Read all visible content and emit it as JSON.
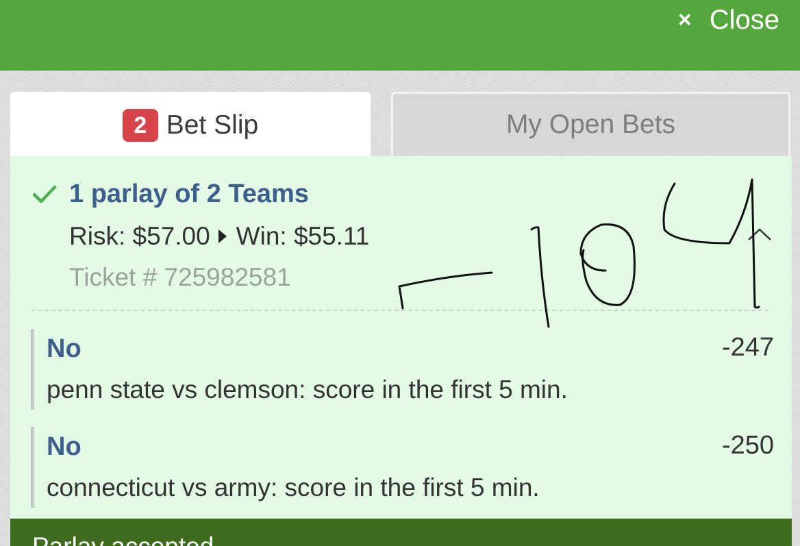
{
  "header": {
    "close_icon": "×",
    "close_label": "Close",
    "bar_color": "#55a63d"
  },
  "tabs": {
    "bet_slip": {
      "badge": "2",
      "label": "Bet Slip"
    },
    "open_bets": {
      "label": "My Open Bets"
    }
  },
  "parlay": {
    "title": "1 parlay of 2 Teams",
    "risk": "Risk: $57.00",
    "win": "Win: $55.11",
    "ticket": "Ticket # 725982581"
  },
  "legs": [
    {
      "pick": "No",
      "odds": "-247",
      "description": "penn state vs clemson: score in the first 5 min."
    },
    {
      "pick": "No",
      "odds": "-250",
      "description": "connecticut vs army: score in the first 5 min."
    }
  ],
  "status": {
    "text": "Parlay accepted"
  },
  "annotation": {
    "text": "-104"
  },
  "colors": {
    "accent_blue": "#3e5f8c",
    "badge_red": "#d9444a",
    "card_green": "#e3fae4",
    "status_green": "#3f6b1f",
    "check_green": "#4caf50"
  }
}
